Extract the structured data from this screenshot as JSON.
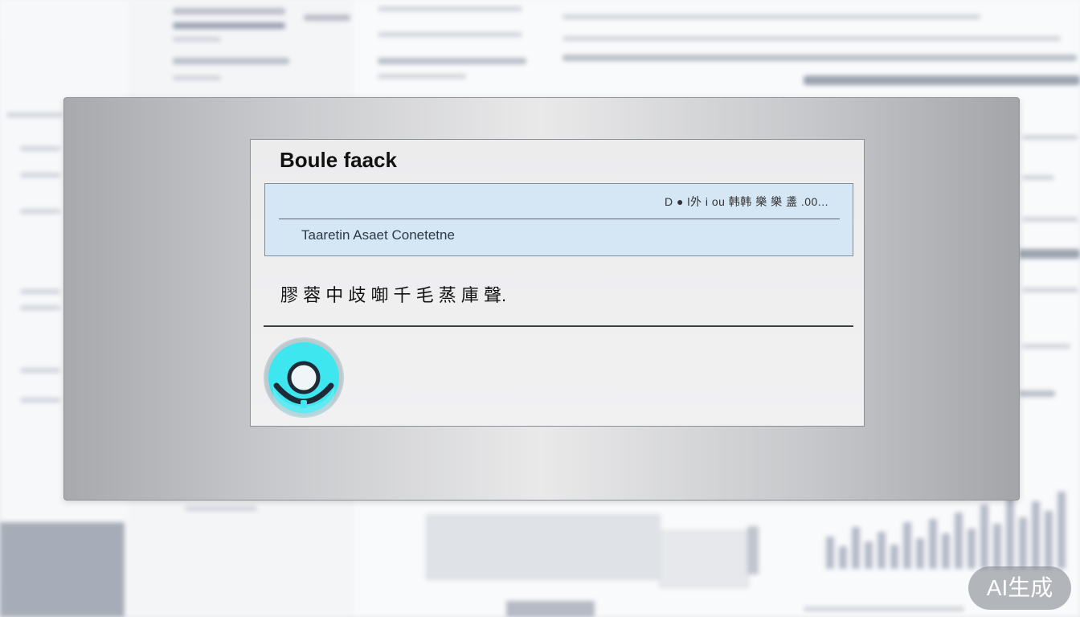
{
  "dialog": {
    "title": "Boule faack",
    "status_text": "D ● l外 i ou 韩韩 樂 樂 盞 .00...",
    "info_label": "Taaretin Asaet Conetetne",
    "message": "膠 蓉 中 歧 啣 千 毛 蒸 庫 聲."
  },
  "watermark": {
    "label": "AI生成"
  },
  "colors": {
    "info_box_bg": "#d5e6f4",
    "icon_cyan": "#3ee6f0",
    "icon_dark": "#1f2a36"
  },
  "icons": {
    "app_icon": "circle-o-icon"
  }
}
